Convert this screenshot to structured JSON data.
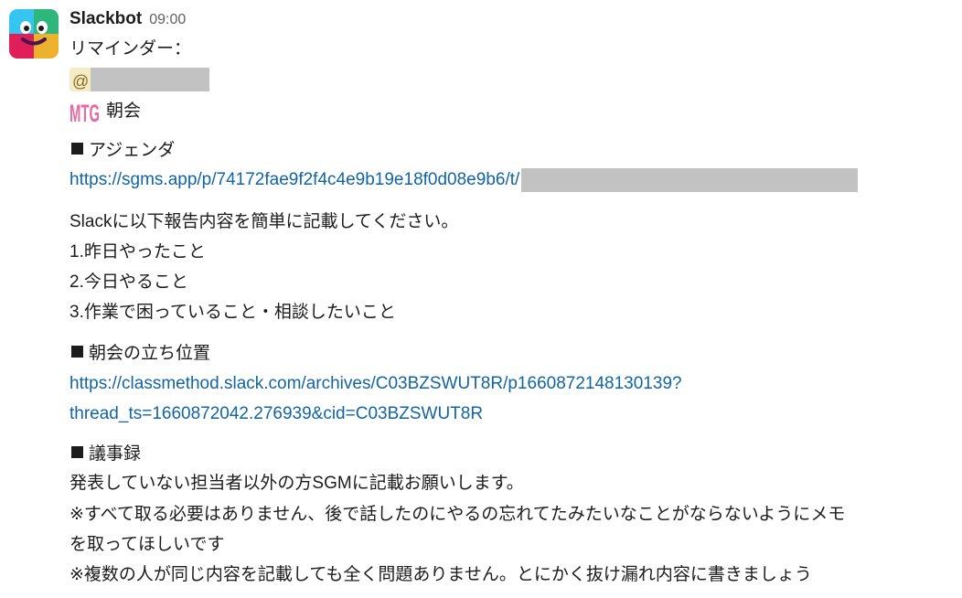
{
  "message": {
    "sender": "Slackbot",
    "time": "09:00",
    "reminder_label": "リマインダー：",
    "mention_prefix": "@",
    "emoji": {
      "name": "mtg-emoji",
      "text": "MTG",
      "color": "#e46aa2"
    },
    "meeting_title": "朝会",
    "sections": {
      "agenda": {
        "heading": "アジェンダ",
        "link": "https://sgms.app/p/74172fae9f2f4c4e9b19e18f0d08e9b6/t/"
      },
      "report": {
        "intro": "Slackに以下報告内容を簡単に記載してください。",
        "items": [
          "1.昨日やったこと",
          "2.今日やること",
          "3.作業で困っていること・相談したいこと"
        ]
      },
      "position": {
        "heading": "朝会の立ち位置",
        "link_line1": "https://classmethod.slack.com/archives/C03BZSWUT8R/p1660872148130139?",
        "link_line2": "thread_ts=1660872042.276939&cid=C03BZSWUT8R"
      },
      "minutes": {
        "heading": "議事録",
        "lines": [
          "発表していない担当者以外の方SGMに記載お願いします。",
          "※すべて取る必要はありません、後で話したのにやるの忘れてたみたいなことがならないようにメモ",
          "を取ってほしいです",
          "※複数の人が同じ内容を記載しても全く問題ありません。とにかく抜け漏れ内容に書きましょう"
        ]
      }
    }
  },
  "colors": {
    "link": "#1264a3",
    "text": "#1d1c1d",
    "muted": "#616061",
    "mention_bg": "#f4ecc6",
    "redaction": "#c2c2c2"
  }
}
